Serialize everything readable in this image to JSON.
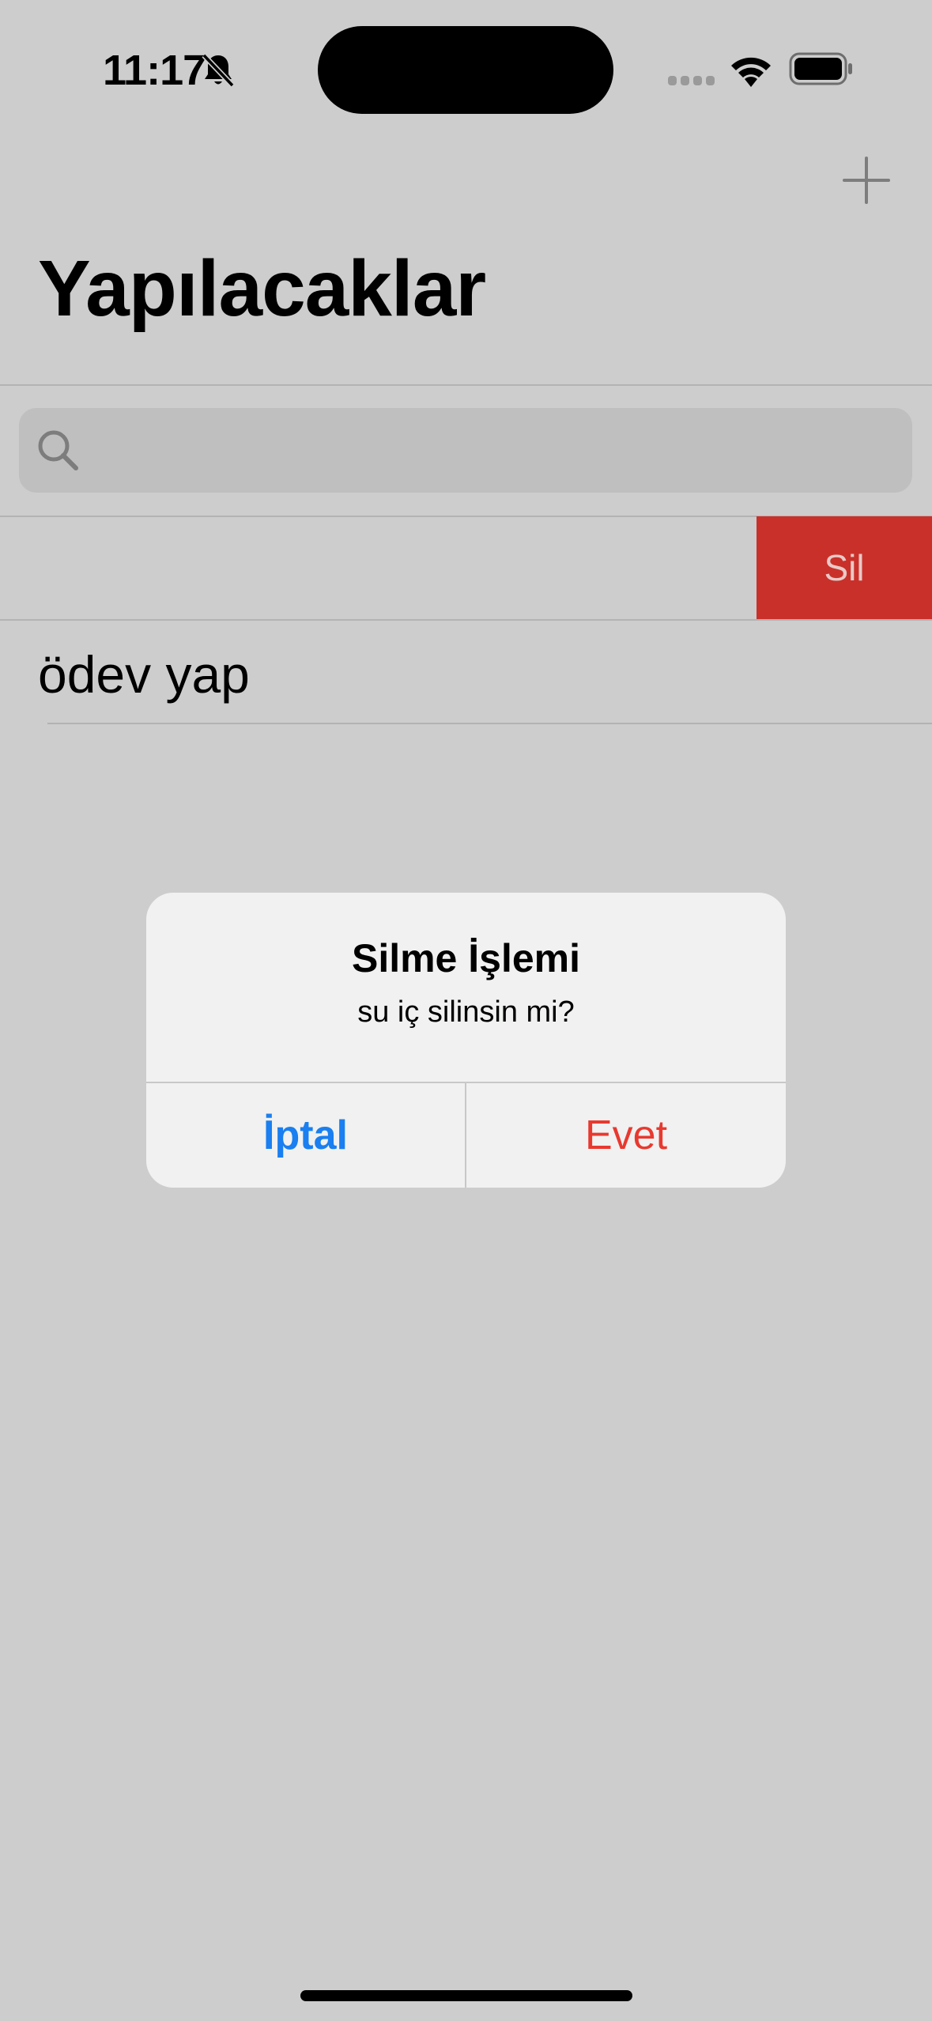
{
  "status_bar": {
    "time": "11:17"
  },
  "nav": {
    "title": "Yapılacaklar"
  },
  "search": {
    "value": "",
    "placeholder": ""
  },
  "swipe_action": {
    "label": "Sil"
  },
  "list": {
    "items": [
      {
        "label": "ödev yap"
      }
    ]
  },
  "alert": {
    "title": "Silme İşlemi",
    "message": "su iç silinsin mi?",
    "cancel_label": "İptal",
    "confirm_label": "Evet"
  },
  "colors": {
    "background": "#cdcdcd",
    "destructive": "#c9302a",
    "alert_link": "#1a7ff0",
    "alert_destructive": "#e8392f"
  },
  "icons": [
    "bell-slash-icon",
    "cellular-signal-icon",
    "wifi-icon",
    "battery-icon",
    "plus-icon",
    "search-icon"
  ]
}
